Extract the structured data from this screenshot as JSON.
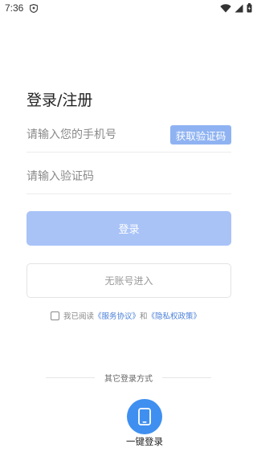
{
  "status_bar": {
    "time": "7:36",
    "icons": [
      "shield-icon",
      "wifi-icon",
      "signal-icon",
      "battery-icon"
    ]
  },
  "page": {
    "title": "登录/注册"
  },
  "form": {
    "phone_placeholder": "请输入您的手机号",
    "phone_value": "",
    "get_code_label": "获取验证码",
    "code_placeholder": "请输入验证码",
    "code_value": ""
  },
  "actions": {
    "login_label": "登录",
    "guest_label": "无账号进入"
  },
  "agreement": {
    "checked": false,
    "prefix": "我已阅读",
    "service_link": "《服务协议》",
    "and": "和",
    "privacy_link": "《隐私权政策》"
  },
  "other_login": {
    "divider_text": "其它登录方式",
    "one_key_label": "一键登录",
    "one_key_icon": "phone-icon"
  },
  "colors": {
    "get_code_bg": "#8fb3f2",
    "login_bg": "#a9c3f7",
    "link": "#4a7fd8",
    "one_key_bg": "#3f8ff0"
  }
}
